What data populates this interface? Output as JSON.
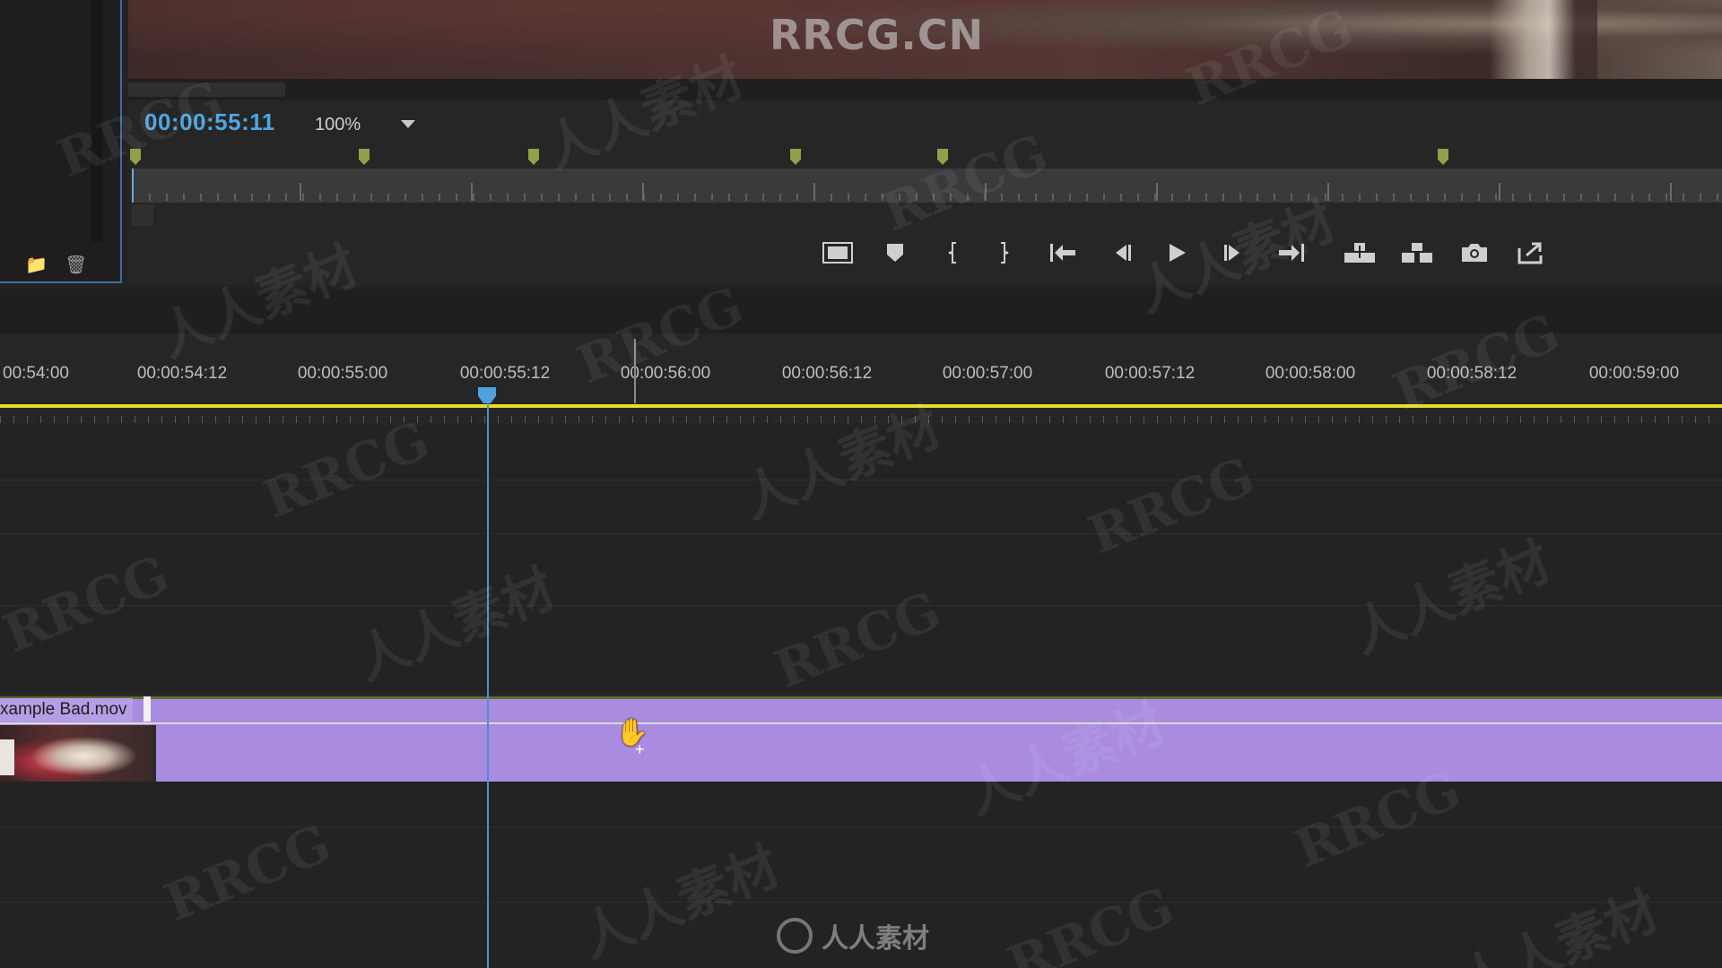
{
  "monitor": {
    "timecode": "00:00:55:11",
    "zoom": "100%",
    "marker_count": 6,
    "transport_icons": [
      "safe-margins-icon",
      "add-marker-icon",
      "mark-in-icon",
      "mark-out-icon",
      "go-to-in-icon",
      "step-back-icon",
      "play-icon",
      "step-forward-icon",
      "go-to-out-icon",
      "lift-icon",
      "extract-icon",
      "export-frame-icon",
      "button-editor-icon"
    ]
  },
  "timeline": {
    "ruler_labels": [
      "00:54:00",
      "00:00:54:12",
      "00:00:55:00",
      "00:00:55:12",
      "00:00:56:00",
      "00:00:56:12",
      "00:00:57:00",
      "00:00:57:12",
      "00:00:58:00",
      "00:00:58:12",
      "00:00:59:00"
    ],
    "clip_name": "xample Bad.mov",
    "clip_color": "#a98ce0",
    "playhead_color": "#4fa1dc",
    "work_area_color": "#e3dd2e"
  },
  "watermarks": {
    "top": "RRCG.CN",
    "bottom": "人人素材",
    "latin": "RRCG",
    "cn": "人人素材"
  }
}
